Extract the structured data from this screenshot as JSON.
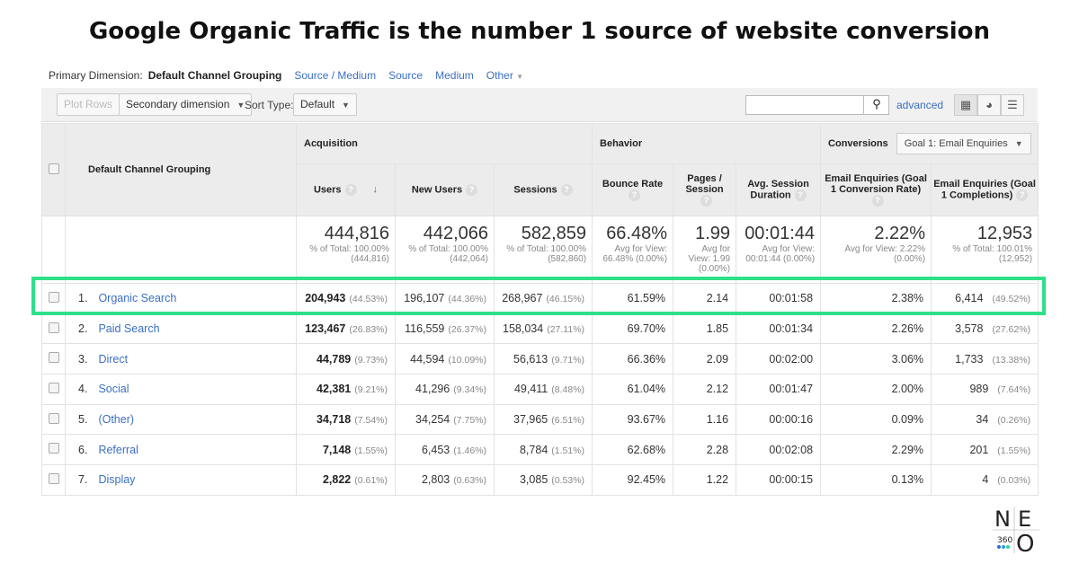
{
  "title": "Google Organic Traffic is the number 1 source of website conversion",
  "primary_dimension": {
    "label": "Primary Dimension:",
    "active": "Default Channel Grouping",
    "links": [
      "Source / Medium",
      "Source",
      "Medium",
      "Other"
    ]
  },
  "toolbar": {
    "plot_rows": "Plot Rows",
    "secondary": "Secondary dimension",
    "sort_label": "Sort Type:",
    "sort_value": "Default",
    "advanced": "advanced"
  },
  "headers": {
    "dimension": "Default Channel Grouping",
    "acquisition": "Acquisition",
    "behavior": "Behavior",
    "conversions": "Conversions",
    "goal": "Goal 1: Email Enquiries",
    "cols": [
      "Users",
      "New Users",
      "Sessions",
      "Bounce Rate",
      "Pages / Session",
      "Avg. Session Duration",
      "Email Enquiries (Goal 1 Conversion Rate)",
      "Email Enquiries (Goal 1 Completions)"
    ]
  },
  "totals": [
    {
      "value": "444,816",
      "sub": "% of Total: 100.00% (444,816)"
    },
    {
      "value": "442,066",
      "sub": "% of Total: 100.00% (442,064)"
    },
    {
      "value": "582,859",
      "sub": "% of Total: 100.00% (582,860)"
    },
    {
      "value": "66.48%",
      "sub": "Avg for View: 66.48% (0.00%)"
    },
    {
      "value": "1.99",
      "sub": "Avg for View: 1.99 (0.00%)"
    },
    {
      "value": "00:01:44",
      "sub": "Avg for View: 00:01:44 (0.00%)"
    },
    {
      "value": "2.22%",
      "sub": "Avg for View: 2.22% (0.00%)"
    },
    {
      "value": "12,953",
      "sub": "% of Total: 100.01% (12,952)"
    }
  ],
  "rows": [
    {
      "n": "1.",
      "name": "Organic Search",
      "users": "204,943",
      "users_pct": "(44.53%)",
      "new": "196,107",
      "new_pct": "(44.36%)",
      "sess": "268,967",
      "sess_pct": "(46.15%)",
      "bounce": "61.59%",
      "pages": "2.14",
      "dur": "00:01:58",
      "conv": "2.38%",
      "comp": "6,414",
      "comp_pct": "(49.52%)"
    },
    {
      "n": "2.",
      "name": "Paid Search",
      "users": "123,467",
      "users_pct": "(26.83%)",
      "new": "116,559",
      "new_pct": "(26.37%)",
      "sess": "158,034",
      "sess_pct": "(27.11%)",
      "bounce": "69.70%",
      "pages": "1.85",
      "dur": "00:01:34",
      "conv": "2.26%",
      "comp": "3,578",
      "comp_pct": "(27.62%)"
    },
    {
      "n": "3.",
      "name": "Direct",
      "users": "44,789",
      "users_pct": "(9.73%)",
      "new": "44,594",
      "new_pct": "(10.09%)",
      "sess": "56,613",
      "sess_pct": "(9.71%)",
      "bounce": "66.36%",
      "pages": "2.09",
      "dur": "00:02:00",
      "conv": "3.06%",
      "comp": "1,733",
      "comp_pct": "(13.38%)"
    },
    {
      "n": "4.",
      "name": "Social",
      "users": "42,381",
      "users_pct": "(9.21%)",
      "new": "41,296",
      "new_pct": "(9.34%)",
      "sess": "49,411",
      "sess_pct": "(8.48%)",
      "bounce": "61.04%",
      "pages": "2.12",
      "dur": "00:01:47",
      "conv": "2.00%",
      "comp": "989",
      "comp_pct": "(7.64%)"
    },
    {
      "n": "5.",
      "name": "(Other)",
      "users": "34,718",
      "users_pct": "(7.54%)",
      "new": "34,254",
      "new_pct": "(7.75%)",
      "sess": "37,965",
      "sess_pct": "(6.51%)",
      "bounce": "93.67%",
      "pages": "1.16",
      "dur": "00:00:16",
      "conv": "0.09%",
      "comp": "34",
      "comp_pct": "(0.26%)"
    },
    {
      "n": "6.",
      "name": "Referral",
      "users": "7,148",
      "users_pct": "(1.55%)",
      "new": "6,453",
      "new_pct": "(1.46%)",
      "sess": "8,784",
      "sess_pct": "(1.51%)",
      "bounce": "62.68%",
      "pages": "2.28",
      "dur": "00:02:08",
      "conv": "2.29%",
      "comp": "201",
      "comp_pct": "(1.55%)"
    },
    {
      "n": "7.",
      "name": "Display",
      "users": "2,822",
      "users_pct": "(0.61%)",
      "new": "2,803",
      "new_pct": "(0.63%)",
      "sess": "3,085",
      "sess_pct": "(0.53%)",
      "bounce": "92.45%",
      "pages": "1.22",
      "dur": "00:00:15",
      "conv": "0.13%",
      "comp": "4",
      "comp_pct": "(0.03%)"
    }
  ],
  "logo": {
    "text": "NEO 360"
  },
  "colors": {
    "highlight": "#2ee08a",
    "link": "#3a6fc4"
  }
}
